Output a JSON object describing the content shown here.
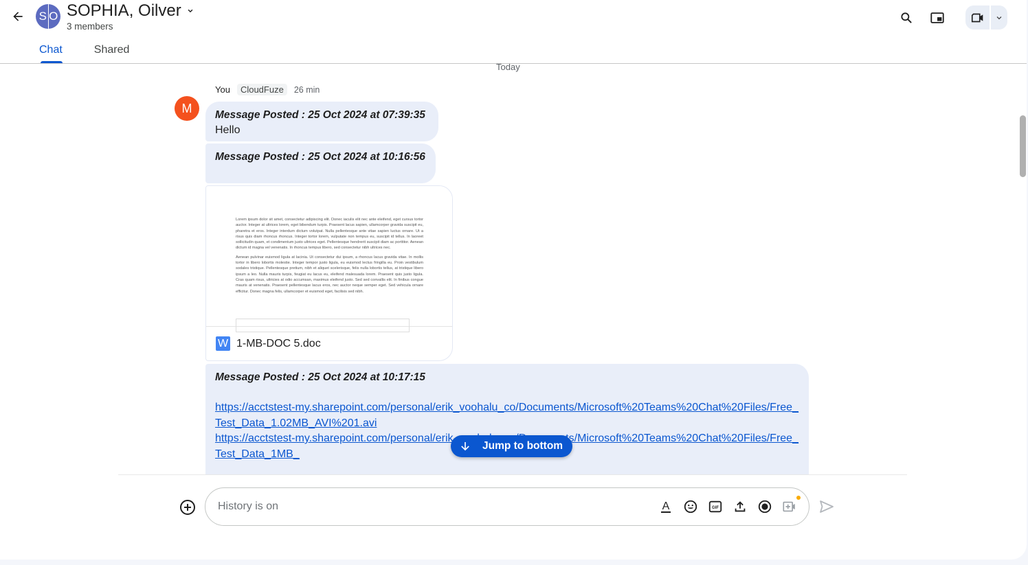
{
  "header": {
    "avatar_initials": [
      "S",
      "O"
    ],
    "title": "SOPHIA, Oilver",
    "members": "3 members",
    "tabs": [
      {
        "label": "Chat",
        "active": true
      },
      {
        "label": "Shared",
        "active": false
      }
    ],
    "icons": [
      "back-arrow-icon",
      "search-icon",
      "picture-in-picture-icon",
      "video-call-icon",
      "chevron-down-icon"
    ]
  },
  "conversation": {
    "date_divider": "Today",
    "sender": {
      "avatar_letter": "M",
      "name": "You",
      "org": "CloudFuze",
      "time": "26 min",
      "avatar_color": "#f4511e"
    },
    "messages": [
      {
        "header": "Message Posted : 25 Oct 2024 at 07:39:35",
        "body": "Hello"
      },
      {
        "header": "Message Posted : 25 Oct 2024 at 10:16:56",
        "body": ""
      },
      {
        "header": "Message Posted : 25 Oct 2024 at 10:17:15",
        "links": [
          "https://acctstest-my.sharepoint.com/personal/erik_voohalu_co/Documents/Microsoft%20Teams%20Chat%20Files/Free_Test_Data_1.02MB_AVI%201.avi",
          "https://acctstest-my.sharepoint.com/personal/erik_voohalu_co/Documents/Microsoft%20Teams%20Chat%20Files/Free_Test_Data_1MB_"
        ]
      }
    ],
    "attachment": {
      "file_name": "1-MB-DOC 5.doc",
      "file_type_letter": "W",
      "preview_paragraphs": [
        "Lorem ipsum dolor sit amet, consectetur adipiscing elit. Donec iaculis elit nec ante eleifend, eget cursus tortor auctor. Integer at ultrices lorem, eget bibendum turpis. Praesent lacus sapien, ullamcorper gravida suscipit eu, pharetra et eros. Integer interdum dictum volutpat. Nulla pellentesque ante vitae sapien luctus ornare. Ut a risus quis diam rhoncus rhoncus. Integer tortor lorem, vulputate non tempus eu, suscipit id tellus. In laoreet sollicitudin quam, et condimentum justo ultrices eget. Pellentesque hendrerit suscipit diam ac porttitor. Aenean dictum id magna vel venenatis. In rhoncus tempus libero, sed consectetur nibh ultrices nec.",
        "Aenean pulvinar euismod ligula at lacinia. Ut consectetur dui ipsum, a rhoncus lacus gravida vitae. In mollis tortor in libero lobortis molestie. Integer tempor justo ligula, eu euismod lectus fringilla eu. Proin vestibulum sodales tristique. Pellentesque pretium, nibh et aliquet scelerisque, felis nulla lobortis tellus, at tristique libero ipsum a leo. Nulla mauris turpis, feugiat eu lacus eu, eleifend malesuada lorem. Praesent quis justo ligula. Cras quam risus, ultricies at odio accumsan, maximus eleifend justo. Sed sed convallis elit. In finibus congue mauris at venenatis. Praesent pellentesque lacus eros, nec auctor neque semper eget. Sed vehicula ornare efficitur. Donec magna felis, ullamcorper et euismod eget, facilisis sed nibh."
      ]
    },
    "jump_to_bottom": "Jump to bottom"
  },
  "composer": {
    "placeholder": "History is on",
    "value": "",
    "tools": [
      "format-text-icon",
      "emoji-icon",
      "gif-icon",
      "upload-icon",
      "record-icon",
      "add-video-meeting-icon"
    ],
    "notification_dot_color": "#f9ab00"
  },
  "colors": {
    "accent": "#0b57d0",
    "bubble_bg": "#e9eef9",
    "group_avatar": "#5c6bc0"
  }
}
